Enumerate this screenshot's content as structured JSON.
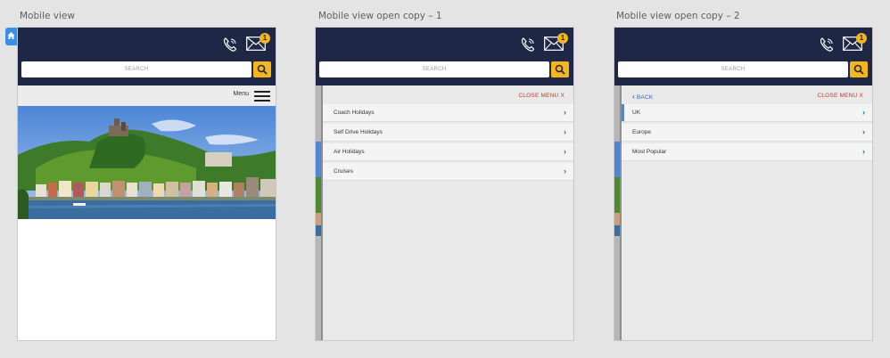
{
  "artboards": [
    {
      "title": "Mobile view"
    },
    {
      "title": "Mobile view open copy – 1"
    },
    {
      "title": "Mobile view open copy – 2"
    }
  ],
  "header": {
    "search_placeholder": "SEARCH",
    "mail_badge": "1",
    "menu_label": "Menu"
  },
  "drawer1": {
    "close_label": "CLOSE MENU  X",
    "items": [
      "Coach Holidays",
      "Self Drive Holidays",
      "Air Holidays",
      "Cruises"
    ]
  },
  "drawer2": {
    "back_label": "BACK",
    "close_label": "CLOSE MENU  X",
    "items": [
      "UK",
      "Europe",
      "Most Popular"
    ]
  },
  "colors": {
    "header_bg": "#1f2747",
    "accent_yellow": "#f5b51c",
    "link_blue": "#2a6ab5",
    "close_red": "#c0392b"
  }
}
